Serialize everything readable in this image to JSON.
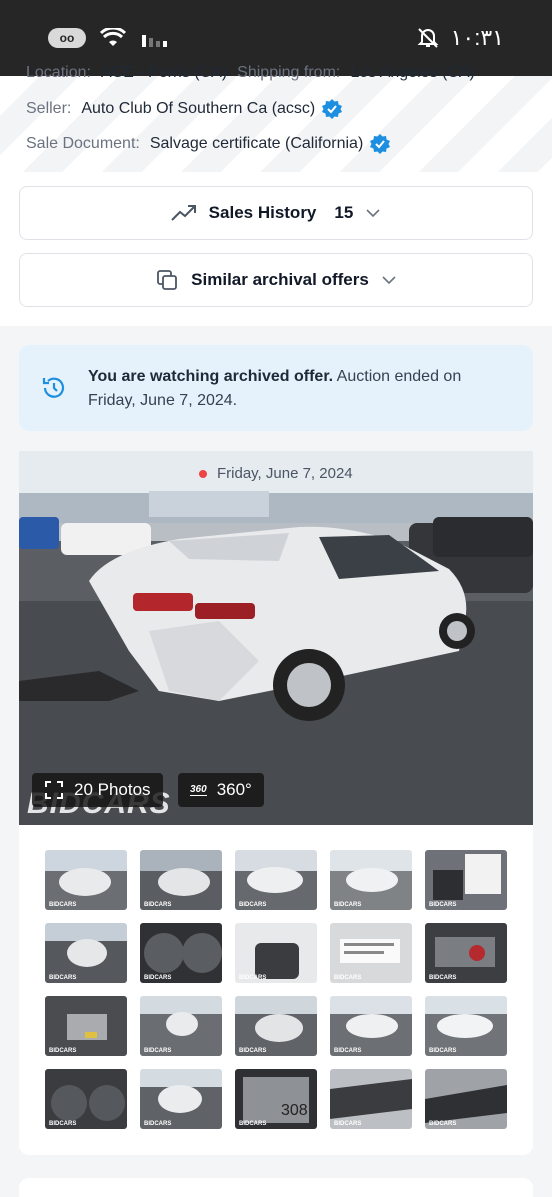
{
  "status_bar": {
    "battery": "oo",
    "time": "١٠:٣١"
  },
  "info": {
    "location_label": "Location:",
    "location_value": "ACE - Perris (CA)",
    "shipping_label": "Shipping from:",
    "shipping_value": "Los Angeles (CA)",
    "seller_label": "Seller:",
    "seller_value": "Auto Club Of Southern Ca (acsc)",
    "sale_doc_label": "Sale Document:",
    "sale_doc_value": "Salvage certificate (California)"
  },
  "sales_history": {
    "label": "Sales History",
    "count": "15"
  },
  "similar": {
    "label": "Similar archival offers"
  },
  "notice": {
    "bold": "You are watching archived offer.",
    "rest": " Auction ended on Friday, June 7, 2024."
  },
  "gallery": {
    "date": "Friday, June 7, 2024",
    "photos_label": "20 Photos",
    "label_360": "360°",
    "icon_360": "360",
    "watermark": "BIDCARS"
  },
  "thumbnail_watermark": "BIDCARS",
  "colors": {
    "accent": "#1d8fe0",
    "status_bar": "#262626",
    "notice_bg": "#e6f2fb"
  }
}
